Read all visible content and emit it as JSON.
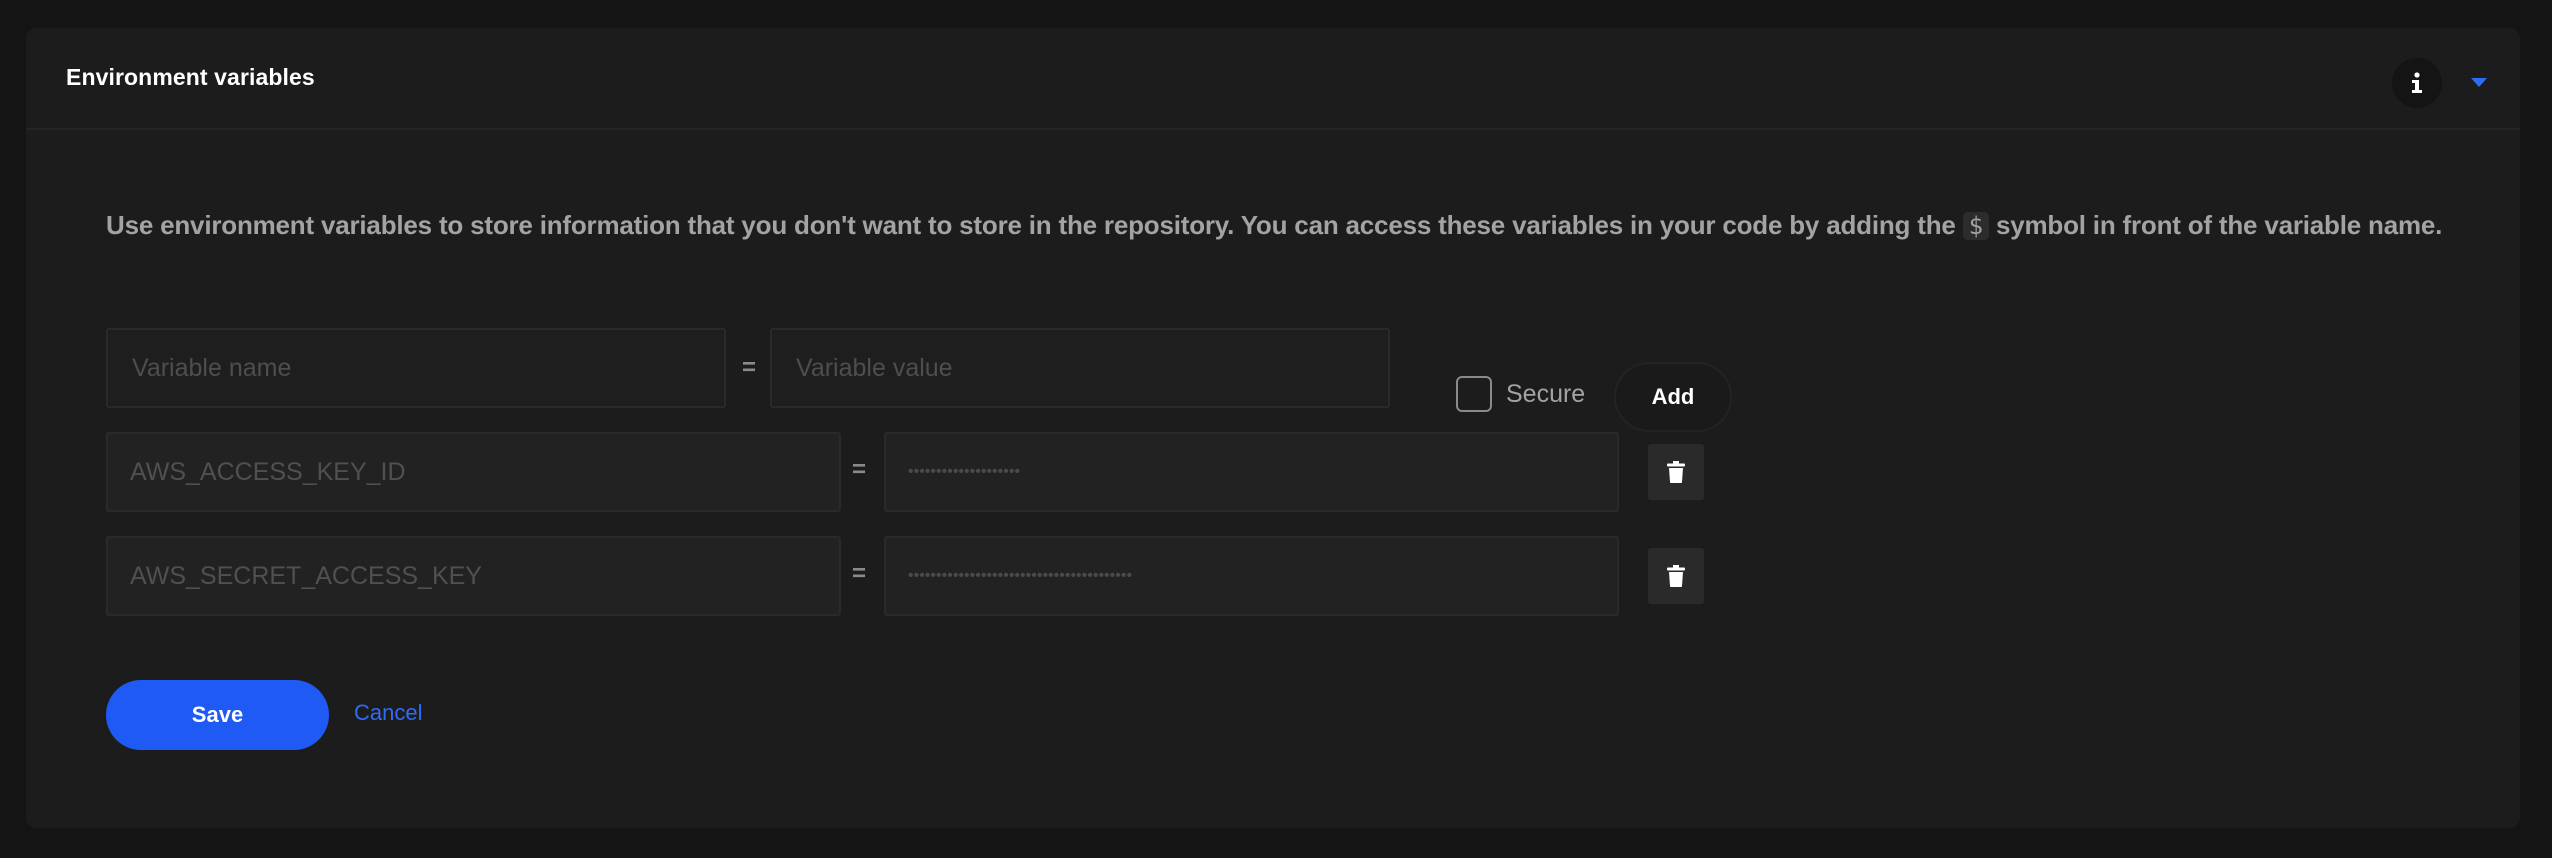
{
  "panel": {
    "title": "Environment variables",
    "info_icon": "info-icon",
    "caret_icon": "caret-down-icon",
    "accent_color": "#1f5af5"
  },
  "description": {
    "before_token": "Use environment variables to store information that you don't want to store in the repository. You can access these variables in your code by adding the ",
    "token": "$",
    "after_token": " symbol in front of the variable name."
  },
  "new_variable": {
    "name_placeholder": "Variable name",
    "name_value": "",
    "equals": "=",
    "value_placeholder": "Variable value",
    "value_value": "",
    "secure_label": "Secure",
    "secure_checked": false,
    "add_label": "Add"
  },
  "variables": [
    {
      "name": "AWS_ACCESS_KEY_ID",
      "equals": "=",
      "value_masked": "••••••••••••••••••••",
      "delete_icon": "trash-icon"
    },
    {
      "name": "AWS_SECRET_ACCESS_KEY",
      "equals": "=",
      "value_masked": "••••••••••••••••••••••••••••••••••••••••",
      "delete_icon": "trash-icon"
    }
  ],
  "actions": {
    "save_label": "Save",
    "cancel_label": "Cancel"
  }
}
